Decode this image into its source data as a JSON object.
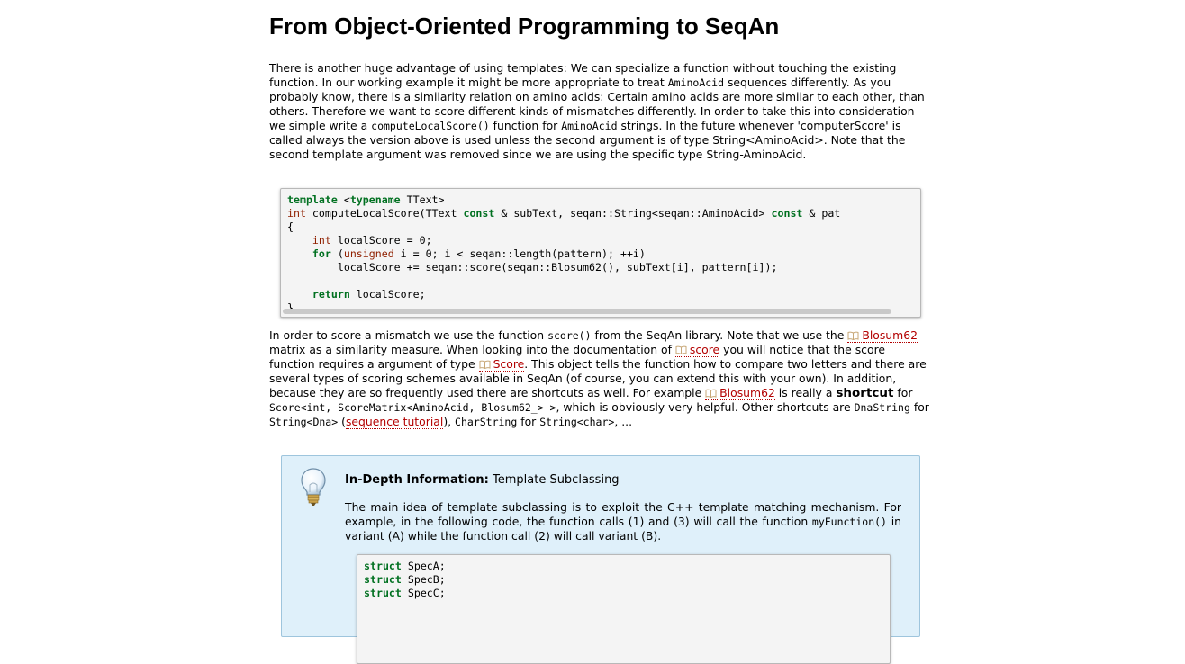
{
  "page": {
    "title": "From Object-Oriented Programming to SeqAn"
  },
  "para1": {
    "t1": "There is another huge advantage of using templates: We can specialize a function without touching the existing function. In our working example it might be more appropriate to treat ",
    "c1": "AminoAcid",
    "t2": " sequences differently. As you probably know, there is a similarity relation on amino acids: Certain amino acids are more similar to each other, than others. Therefore we want to score different kinds of mismatches differently. In order to take this into consideration we simple write a ",
    "c2": "computeLocalScore()",
    "t3": " function for ",
    "c3": "AminoAcid",
    "t4": " strings. In the future whenever 'computerScore' is called always the version above is used unless the second argument is of type String<AminoAcid>. Note that the second template argument was removed since we are using the specific type String-AminoAcid."
  },
  "code1": {
    "line1_a": "template",
    "line1_b": " <",
    "line1_c": "typename",
    "line1_d": " TText>",
    "line2_a": "int",
    "line2_b": " computeLocalScore(TText ",
    "line2_c": "const",
    "line2_d": " & subText, seqan::String<seqan::AminoAcid> ",
    "line2_e": "const",
    "line2_f": " & pat",
    "line3": "{",
    "line4_a": "    ",
    "line4_b": "int",
    "line4_c": " localScore = 0;",
    "line5_a": "    ",
    "line5_b": "for",
    "line5_c": " (",
    "line5_d": "unsigned",
    "line5_e": " i = 0; i < seqan::length(pattern); ++i)",
    "line6": "        localScore += seqan::score(seqan::Blosum62(), subText[i], pattern[i]);",
    "line7": "",
    "line8_a": "    ",
    "line8_b": "return",
    "line8_c": " localScore;",
    "line9": "}"
  },
  "para2": {
    "t1": "In order to score a mismatch we use the function ",
    "c1": "score()",
    "t2": " from the SeqAn library. Note that we use the ",
    "l1": "Blosum62",
    "t3": " matrix as a similarity measure. When looking into the documentation of ",
    "l2": "score",
    "t4": " you will notice that the score function requires a argument of type ",
    "l3": "Score",
    "t5": ". This object tells the function how to compare two letters and there are several types of scoring schemes available in SeqAn (of course, you can extend this with your own). In addition, because they are so frequently used there are shortcuts as well. For example ",
    "l4": "Blosum62",
    "t6": " is really a ",
    "b1": "shortcut",
    "t7": " for ",
    "c2": "Score<int, ScoreMatrix<AminoAcid, Blosum62_> >",
    "t8": ", which is obviously very helpful. Other shortcuts are ",
    "c3": "DnaString",
    "t9": " for ",
    "c4": "String<Dna>",
    "t10": " (",
    "l5": "sequence tutorial",
    "t11": "), ",
    "c5": "CharString",
    "t12": " for ",
    "c6": "String<char>",
    "t13": ", ..."
  },
  "info": {
    "title_bold": "In-Depth Information:",
    "title_rest": " Template Subclassing",
    "t1": "The main idea of template subclassing is to exploit the C++ template matching mechanism. For example, in the following code, the function calls (1) and (3) will call the function ",
    "c1": "myFunction()",
    "t2": " in variant (A) while the function call (2) will call variant (B).",
    "code_l1_kw": "struct",
    "code_l1_rest": " SpecA;",
    "code_l2_kw": "struct",
    "code_l2_rest": " SpecB;",
    "code_l3_kw": "struct",
    "code_l3_rest": " SpecC;"
  },
  "icons": {
    "book": "book-icon",
    "bulb": "lightbulb-icon"
  },
  "colors": {
    "keyword": "#007020",
    "type": "#902000",
    "link": "#b30000",
    "info_bg": "#dff0fa"
  }
}
